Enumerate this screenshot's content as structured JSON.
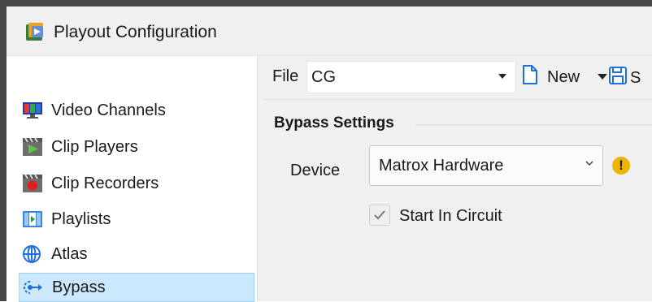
{
  "window": {
    "title": "Playout Configuration"
  },
  "sidebar": {
    "items": [
      {
        "label": "Video Channels",
        "icon": "monitor-icon"
      },
      {
        "label": "Clip Players",
        "icon": "clapper-play-icon"
      },
      {
        "label": "Clip Recorders",
        "icon": "clapper-record-icon"
      },
      {
        "label": "Playlists",
        "icon": "playlist-icon"
      },
      {
        "label": "Atlas",
        "icon": "globe-icon"
      },
      {
        "label": "Bypass",
        "icon": "bypass-icon",
        "selected": true
      }
    ]
  },
  "toolbar": {
    "file_label": "File",
    "file_value": "CG",
    "new_label": "New",
    "save_label": "S"
  },
  "bypass": {
    "group_title": "Bypass Settings",
    "device_label": "Device",
    "device_value": "Matrox Hardware",
    "warning_symbol": "!",
    "start_in_circuit_label": "Start In Circuit",
    "start_in_circuit_checked": true
  },
  "colors": {
    "selection_bg": "#cce8ff",
    "selection_border": "#99d1ff",
    "warning": "#f0b400",
    "accent_blue": "#1e6fd9"
  }
}
